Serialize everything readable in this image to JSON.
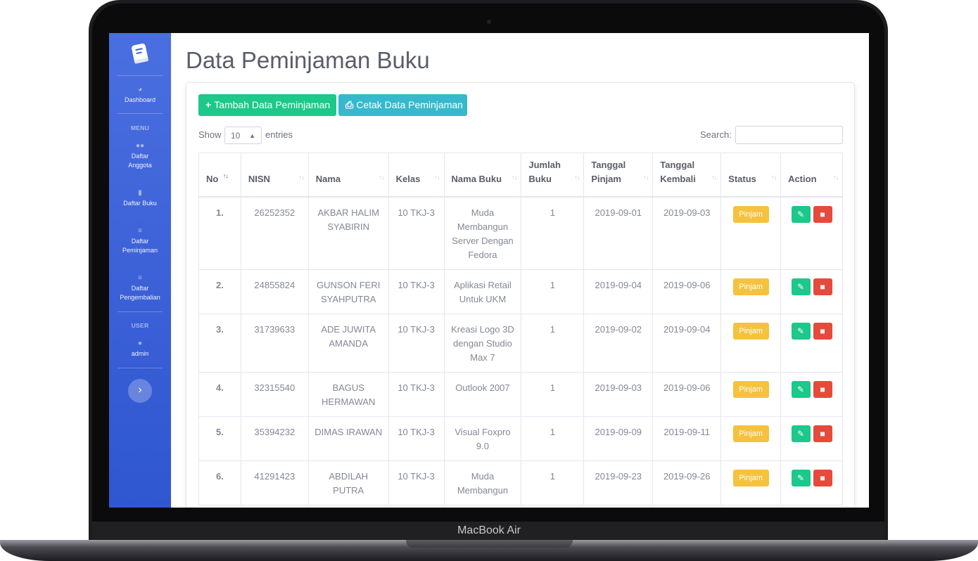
{
  "device": {
    "brand": "MacBook Air"
  },
  "sidebar": {
    "logo_icon": "book-icon",
    "items": [
      {
        "label": "Dashboard",
        "icon": "dashboard-icon"
      },
      {
        "label_1": "Daftar",
        "label_2": "Anggota",
        "icon": "users-icon"
      },
      {
        "label": "Daftar Buku",
        "icon": "book-icon"
      },
      {
        "label_1": "Daftar",
        "label_2": "Peminjaman",
        "icon": "list-icon"
      },
      {
        "label_1": "Daftar",
        "label_2": "Pengembalian",
        "icon": "list-icon"
      },
      {
        "label": "admin",
        "icon": "user-icon"
      }
    ],
    "headings": {
      "menu": "MENU",
      "user": "USER"
    },
    "toggle_icon": "chevron-right-icon"
  },
  "page": {
    "title": "Data Peminjaman Buku"
  },
  "toolbar": {
    "add_label": "Tambah Data Peminjaman",
    "print_label": "Cetak Data Peminjaman"
  },
  "table_controls": {
    "show_label": "Show",
    "entries_value": "10",
    "entries_label": "entries",
    "search_label": "Search:",
    "search_value": ""
  },
  "table": {
    "headers": [
      "No",
      "NISN",
      "Nama",
      "Kelas",
      "Nama Buku",
      "Jumlah Buku",
      "Tanggal Pinjam",
      "Tanggal Kembali",
      "Status",
      "Action"
    ],
    "rows": [
      {
        "no": "1.",
        "nisn": "26252352",
        "nama": "AKBAR HALIM SYABIRIN",
        "kelas": "10 TKJ-3",
        "buku": "Muda Membangun Server Dengan Fedora",
        "jumlah": "1",
        "pinjam": "2019-09-01",
        "kembali": "2019-09-03",
        "status": "Pinjam"
      },
      {
        "no": "2.",
        "nisn": "24855824",
        "nama": "GUNSON FERI SYAHPUTRA",
        "kelas": "10 TKJ-3",
        "buku": "Aplikasi Retail Untuk UKM",
        "jumlah": "1",
        "pinjam": "2019-09-04",
        "kembali": "2019-09-06",
        "status": "Pinjam"
      },
      {
        "no": "3.",
        "nisn": "31739633",
        "nama": "ADE JUWITA AMANDA",
        "kelas": "10 TKJ-3",
        "buku": "Kreasi Logo 3D dengan Studio Max 7",
        "jumlah": "1",
        "pinjam": "2019-09-02",
        "kembali": "2019-09-04",
        "status": "Pinjam"
      },
      {
        "no": "4.",
        "nisn": "32315540",
        "nama": "BAGUS HERMAWAN",
        "kelas": "10 TKJ-3",
        "buku": "Outlook 2007",
        "jumlah": "1",
        "pinjam": "2019-09-03",
        "kembali": "2019-09-06",
        "status": "Pinjam"
      },
      {
        "no": "5.",
        "nisn": "35394232",
        "nama": "DIMAS IRAWAN",
        "kelas": "10 TKJ-3",
        "buku": "Visual Foxpro 9.0",
        "jumlah": "1",
        "pinjam": "2019-09-09",
        "kembali": "2019-09-11",
        "status": "Pinjam"
      },
      {
        "no": "6.",
        "nisn": "41291423",
        "nama": "ABDILAH PUTRA",
        "kelas": "10 TKJ-3",
        "buku": "Muda Membangun",
        "jumlah": "1",
        "pinjam": "2019-09-23",
        "kembali": "2019-09-26",
        "status": "Pinjam"
      }
    ]
  },
  "colors": {
    "sidebar": "#3a5fd6",
    "success": "#1cc88a",
    "info": "#36b9cc",
    "warning": "#f6c23e",
    "danger": "#e74a3b"
  }
}
